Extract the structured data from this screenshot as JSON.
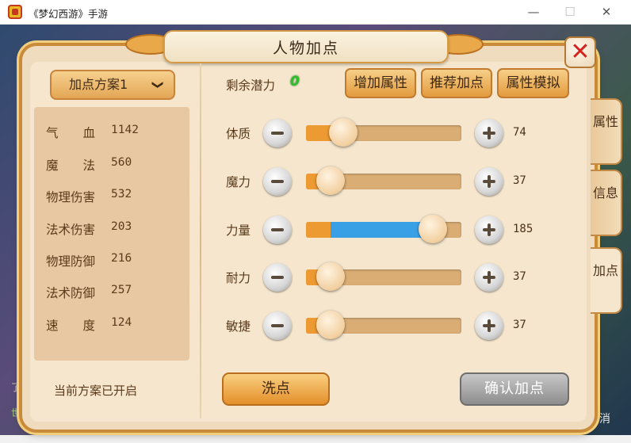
{
  "window": {
    "title": "《梦幻西游》手游",
    "minimize": "—",
    "maximize": "☐",
    "close": "✕"
  },
  "panel": {
    "title": "人物加点",
    "close_icon": "close-x-icon"
  },
  "scheme": {
    "selected": "加点方案1",
    "chevron": "❯"
  },
  "stats": [
    {
      "label": "气　　血",
      "value": "1142"
    },
    {
      "label": "魔　　法",
      "value": "560"
    },
    {
      "label": "物理伤害",
      "value": "532"
    },
    {
      "label": "法术伤害",
      "value": "203"
    },
    {
      "label": "物理防御",
      "value": "216"
    },
    {
      "label": "法术防御",
      "value": "257"
    },
    {
      "label": "速　　度",
      "value": "124"
    }
  ],
  "current_scheme_text": "当前方案已开启",
  "remaining": {
    "label": "剩余潜力",
    "value": "0"
  },
  "top_buttons": {
    "add_attr": "增加属性",
    "recommend": "推荐加点",
    "simulate": "属性模拟"
  },
  "attributes": [
    {
      "label": "体质",
      "value": "74",
      "base_fraction": 0.16,
      "added_fraction": 0.08
    },
    {
      "label": "魔力",
      "value": "37",
      "base_fraction": 0.16,
      "added_fraction": 0.0
    },
    {
      "label": "力量",
      "value": "185",
      "base_fraction": 0.16,
      "added_fraction": 0.66
    },
    {
      "label": "耐力",
      "value": "37",
      "base_fraction": 0.16,
      "added_fraction": 0.0
    },
    {
      "label": "敏捷",
      "value": "37",
      "base_fraction": 0.16,
      "added_fraction": 0.0
    }
  ],
  "bottom_buttons": {
    "wash": "洗点",
    "confirm": "确认加点"
  },
  "side_tabs": [
    "属性",
    "信息",
    "加点"
  ],
  "background_texts": {
    "cancel": "取消",
    "left1": "了",
    "left2": "世"
  },
  "colors": {
    "panel_bg": "#f5e6cd",
    "slider_orange": "#ee9a32",
    "slider_blue": "#3aa0e6",
    "remaining_green": "#2fbf2a",
    "close_red": "#d3231c"
  }
}
